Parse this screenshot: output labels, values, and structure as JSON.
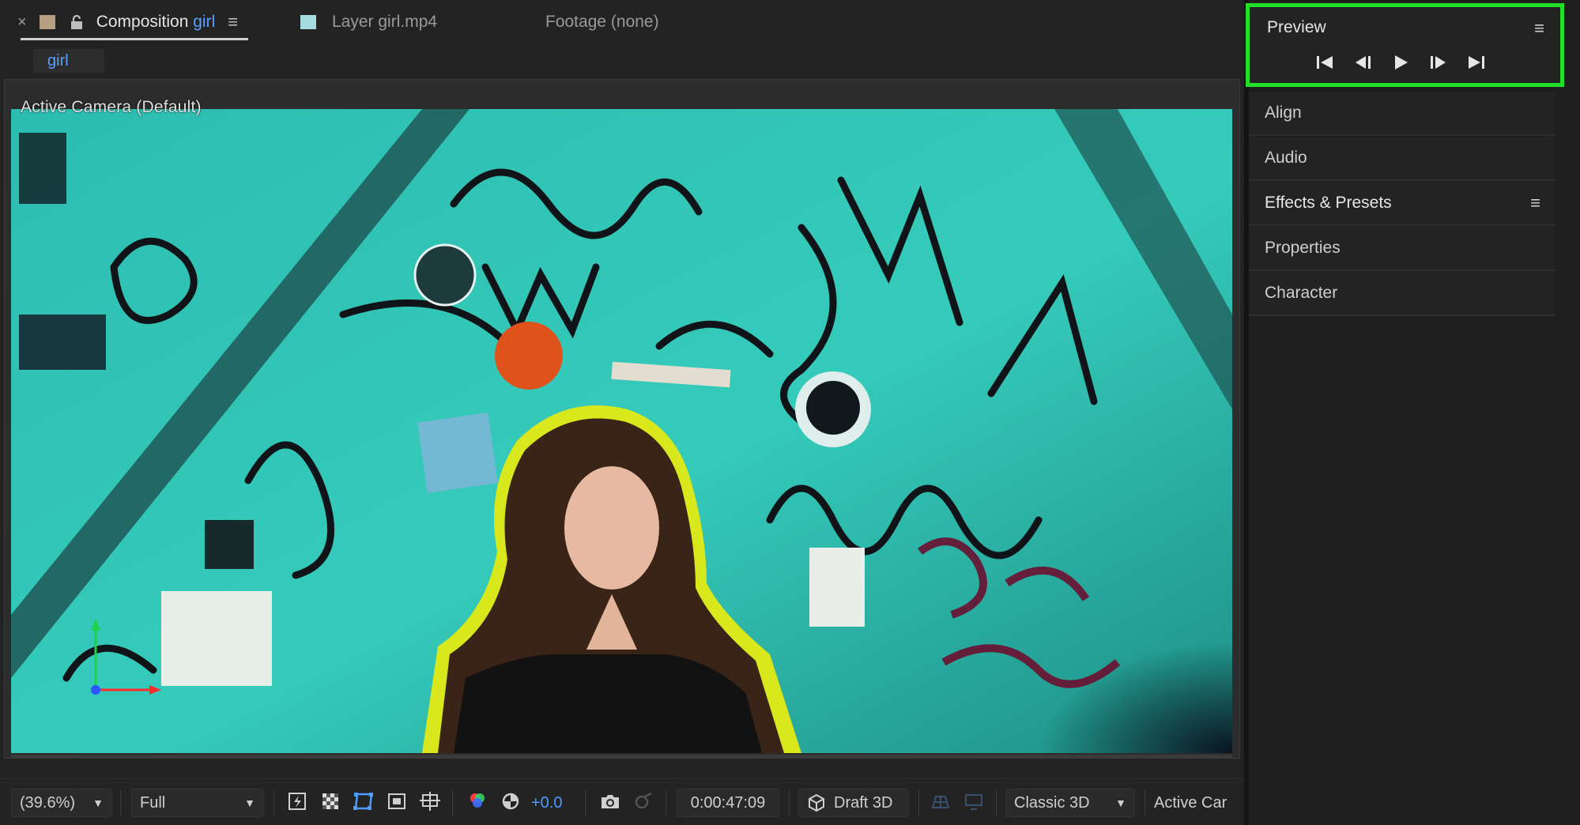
{
  "tabs": {
    "composition": {
      "prefix": "Composition ",
      "name": "girl",
      "close": "×",
      "menu": "≡"
    },
    "layer": {
      "label": "Layer girl.mp4"
    },
    "footage": {
      "label": "Footage (none)"
    }
  },
  "comp_chip": "girl",
  "viewer": {
    "camera_label": "Active Camera (Default)"
  },
  "toolbar": {
    "zoom": "(39.6%)",
    "resolution": "Full",
    "exposure": "+0.0",
    "timecode": "0:00:47:09",
    "renderer": "Draft 3D",
    "view_layout": "Classic 3D",
    "camera": "Active Car"
  },
  "preview_panel": {
    "title": "Preview",
    "menu": "≡",
    "controls": [
      "first-frame",
      "previous-frame",
      "play",
      "next-frame",
      "last-frame"
    ]
  },
  "side_panels": [
    {
      "label": "Align",
      "menu": ""
    },
    {
      "label": "Audio",
      "menu": ""
    },
    {
      "label": "Effects & Presets",
      "menu": "≡"
    },
    {
      "label": "Properties",
      "menu": ""
    },
    {
      "label": "Character",
      "menu": ""
    }
  ],
  "colors": {
    "highlight_green": "#22e02a",
    "accent_blue": "#5aa0ff",
    "footage_teal": "#2ec3b4",
    "outline_yellow": "#d8e81c"
  }
}
